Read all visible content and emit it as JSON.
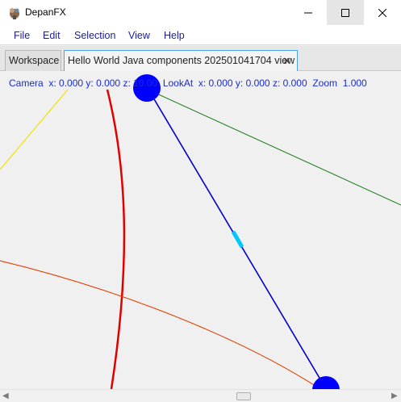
{
  "window": {
    "title": "DepanFX",
    "app_icon": "depanfx-logo-icon",
    "controls": [
      "minimize-icon",
      "maximize-icon",
      "close-icon"
    ]
  },
  "menu": {
    "items": [
      "File",
      "Edit",
      "Selection",
      "View",
      "Help"
    ]
  },
  "tabs": {
    "items": [
      {
        "label": "Workspace",
        "active": false
      },
      {
        "label": "Hello World Java components 202501041704 view",
        "active": true,
        "close": "✕"
      }
    ]
  },
  "status": {
    "camera_label": "Camera",
    "camera_x": "x: 0.000",
    "camera_y": "y: 0.000",
    "camera_z": "z: 10.00",
    "lookat_label": "LookAt",
    "lookat_x": "x: 0.000",
    "lookat_y": "y: 0.000",
    "lookat_z": "z: 0.000",
    "zoom_label": "Zoom",
    "zoom_value": "1.000"
  },
  "colors": {
    "node": "#0000ff",
    "edge_blue": "#0000cc",
    "edge_highlight": "#00c8ff",
    "edge_green": "#1a7a1a",
    "edge_yellow": "#f0e000",
    "edge_red": "#e00000",
    "edge_orange": "#e04000",
    "status_text": "#1a2cd0"
  }
}
